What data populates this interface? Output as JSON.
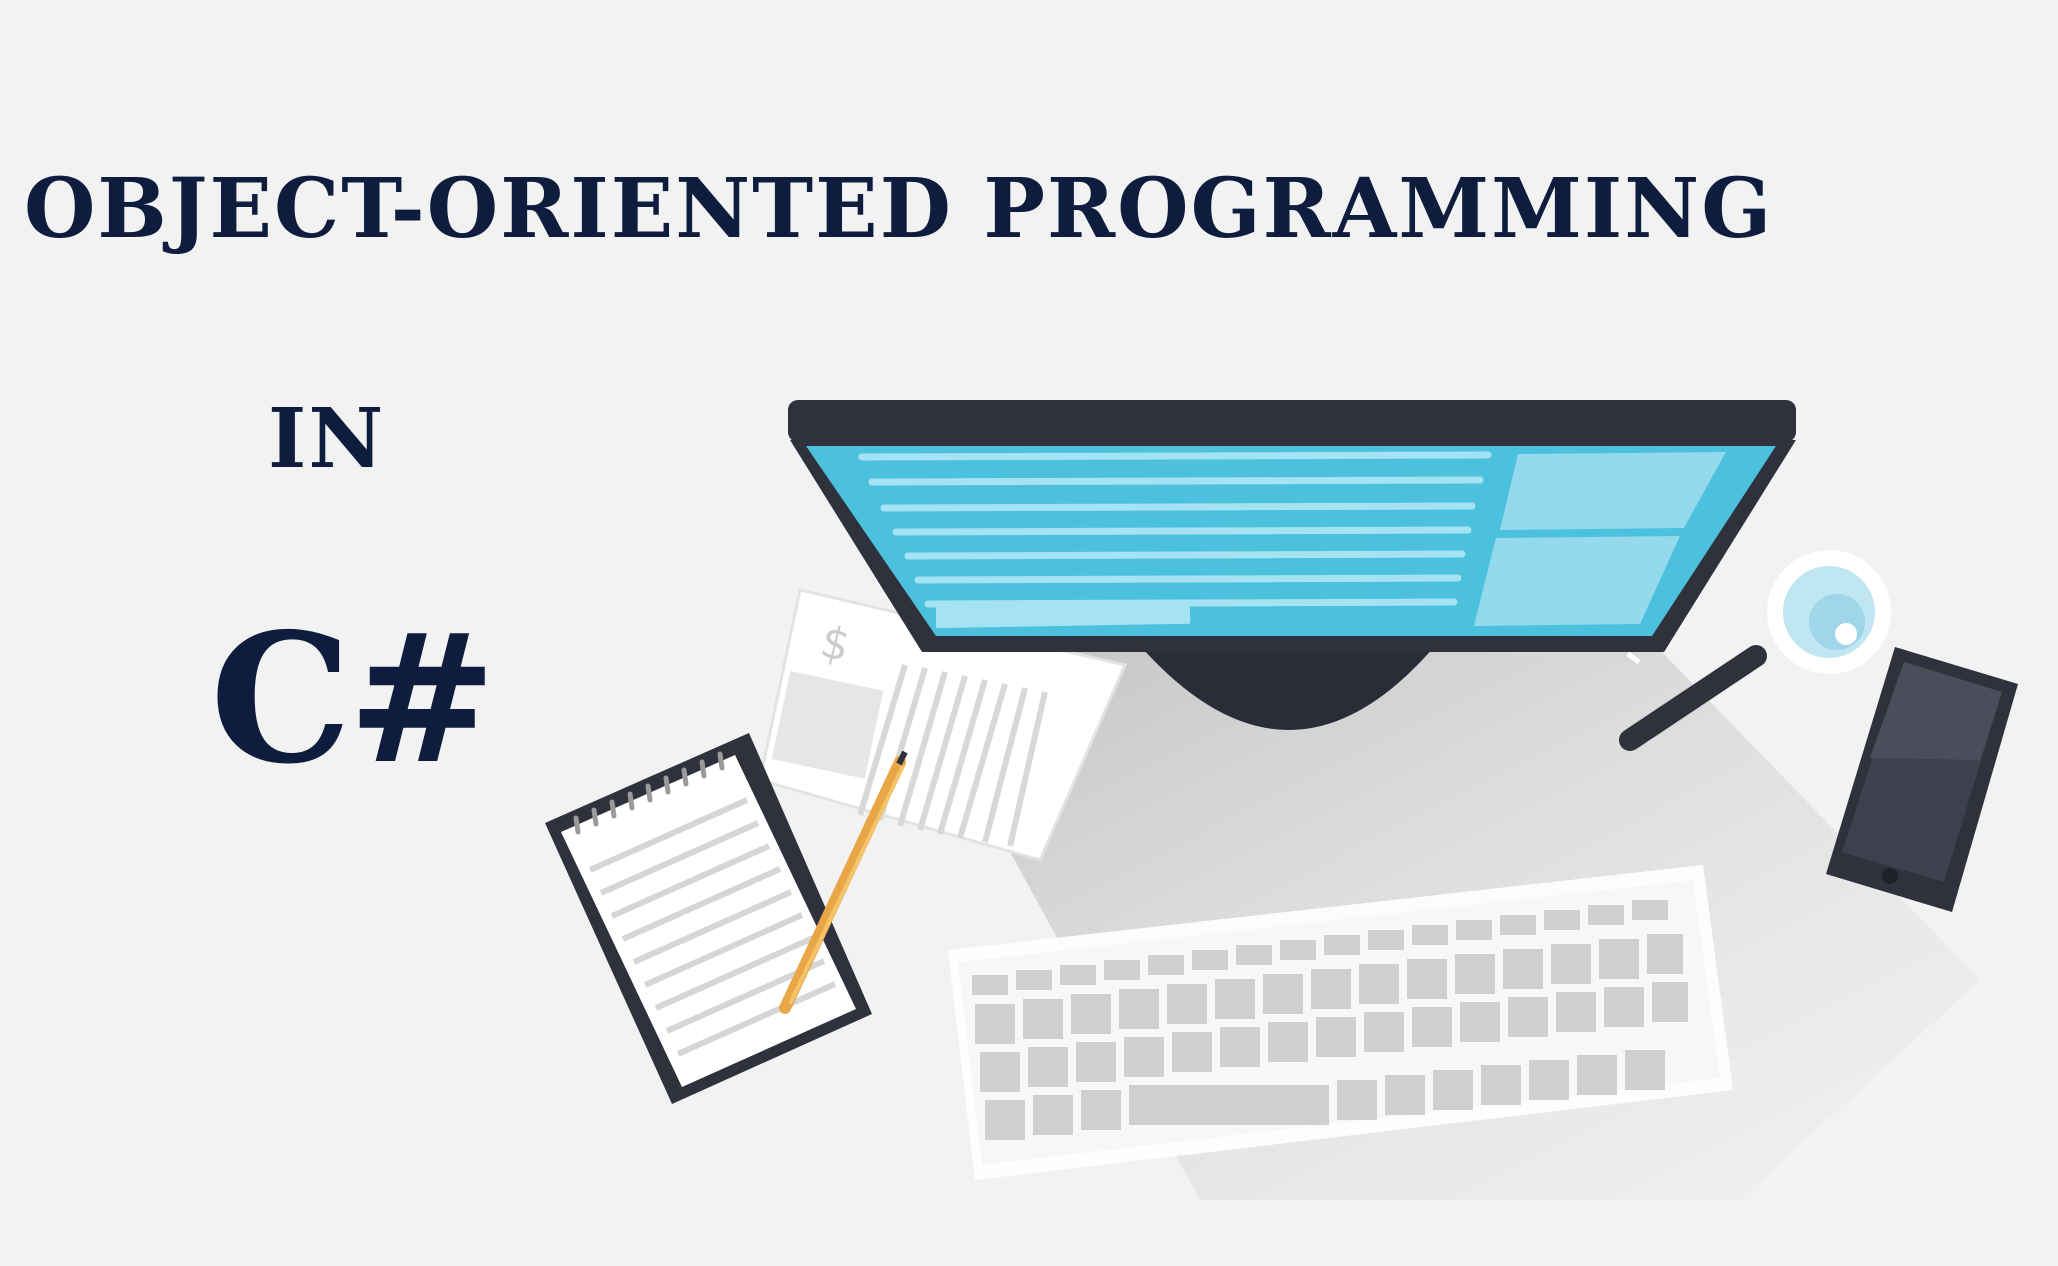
{
  "title": {
    "line1": "OBJECT-ORIENTED PROGRAMMING",
    "line2": "IN",
    "line3": "C#"
  },
  "colors": {
    "background": "#f2f2f2",
    "title_text": "#0e1d3e",
    "monitor_frame": "#2f323c",
    "screen": "#4bc1de",
    "screen_panel": "#94d9ec"
  },
  "illustration": {
    "objects": [
      "monitor",
      "keyboard",
      "notepad",
      "pencil",
      "invoice-papers",
      "magnifying-glass",
      "smartphone"
    ]
  }
}
